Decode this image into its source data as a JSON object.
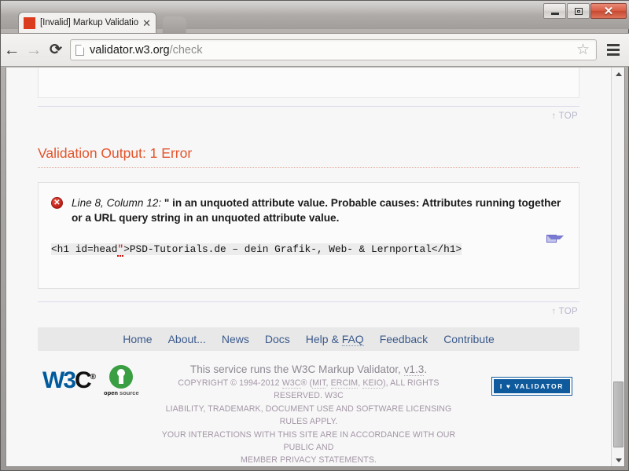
{
  "window": {
    "controls": {
      "minimize": "–",
      "maximize": "□",
      "close": "✕"
    }
  },
  "browser": {
    "tab": {
      "title": "[Invalid] Markup Validatio",
      "close_label": "✕",
      "favicon": "page-favicon"
    },
    "toolbar": {
      "back": "←",
      "forward": "→",
      "reload": "⟳",
      "url_host": "validator.w3.org",
      "url_path": "/check",
      "bookmark": "☆",
      "menu": "hamburger-icon"
    }
  },
  "page": {
    "top_link_1": "↑ TOP",
    "top_link_2": "↑ TOP",
    "validation_heading": "Validation Output: 1 Error",
    "error": {
      "location": "Line 8, Column 12",
      "separator": ":",
      "message": "\" in an unquoted attribute value. Probable causes: Attributes running together or a URL query string in an unquoted attribute value.",
      "code_before": "<h1 id=head",
      "code_highlight": "\"",
      "code_after": ">PSD-Tutorials.de – dein Grafik-, Web- & Lernportal</h1>",
      "icon": "error-circle-icon",
      "mail_icon": "envelope-icon"
    },
    "nav": [
      {
        "label": "Home"
      },
      {
        "label": "About..."
      },
      {
        "label": "News"
      },
      {
        "label": "Docs"
      },
      {
        "label": "Help & ",
        "abbr": "FAQ"
      },
      {
        "label": "Feedback"
      },
      {
        "label": "Contribute"
      }
    ],
    "footer": {
      "lead_before": "This service runs the W3C Markup Validator, ",
      "lead_link": "v1.3",
      "lead_after": ".",
      "legal_line1_a": "COPYRIGHT © 1994-2012 ",
      "legal_w3c": "W3C",
      "legal_line1_b": "® (",
      "legal_mit": "MIT",
      "legal_sep1": ", ",
      "legal_ercim": "ERCIM",
      "legal_sep2": ", ",
      "legal_keio": "KEIO",
      "legal_line1_c": "), ALL RIGHTS RESERVED. W3C",
      "legal_line2": "LIABILITY, TRADEMARK, DOCUMENT USE AND SOFTWARE LICENSING RULES APPLY.",
      "legal_line3": "YOUR INTERACTIONS WITH THIS SITE ARE IN ACCORDANCE WITH OUR PUBLIC AND",
      "legal_line4": "MEMBER PRIVACY STATEMENTS.",
      "w3c_logo_w3": "W3",
      "w3c_logo_c": "C",
      "w3c_logo_reg": "®",
      "opensource_open": "open",
      "opensource_source": " source",
      "opensource_tm": "™",
      "validator_badge": "I ♥ VALIDATOR"
    }
  },
  "colors": {
    "error_red": "#e4542c",
    "link_blue": "#3b5a8c",
    "w3c_blue": "#005a9c",
    "opensource_green": "#3a9e42",
    "badge_blue": "#0e5a9c"
  }
}
